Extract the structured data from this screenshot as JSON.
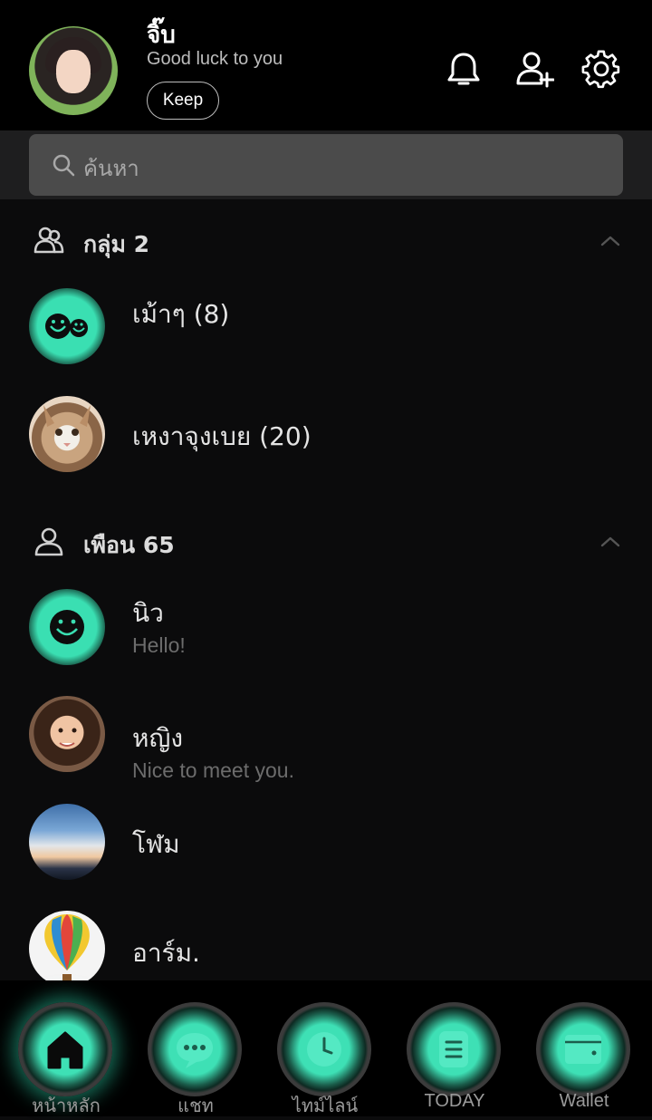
{
  "profile": {
    "name": "จิ๊บ",
    "status": "Good luck to you",
    "keep_label": "Keep"
  },
  "header_icons": [
    "bell-icon",
    "add-friend-icon",
    "gear-icon"
  ],
  "search": {
    "placeholder": "ค้นหา"
  },
  "groups": {
    "title": "กลุ่ม 2",
    "items": [
      {
        "name": "เม้าๆ (8)",
        "avatar": "teal-duo-smiley"
      },
      {
        "name": "เหงาจุงเบย (20)",
        "avatar": "cat-photo"
      }
    ]
  },
  "friends": {
    "title": "เพือน 65",
    "items": [
      {
        "name": "นิว",
        "status": "Hello!",
        "avatar": "teal-smiley"
      },
      {
        "name": "หญิง",
        "status": "Nice to meet you.",
        "avatar": "woman-photo"
      },
      {
        "name": "โฬม",
        "status": "",
        "avatar": "sky-photo"
      },
      {
        "name": "อาร์ม.",
        "status": "",
        "avatar": "balloon-photo"
      }
    ]
  },
  "nav": {
    "items": [
      {
        "label": "หน้าหลัก",
        "icon": "home-icon",
        "active": true
      },
      {
        "label": "แชท",
        "icon": "chat-icon",
        "active": false
      },
      {
        "label": "ไทม์ไลน์",
        "icon": "clock-icon",
        "active": false
      },
      {
        "label": "TODAY",
        "icon": "news-icon",
        "active": false
      },
      {
        "label": "Wallet",
        "icon": "wallet-icon",
        "active": false
      }
    ]
  },
  "colors": {
    "accent": "#3ee0b5",
    "background": "#0b0b0c",
    "header": "#000000",
    "search_bg": "#4b4b4b"
  }
}
